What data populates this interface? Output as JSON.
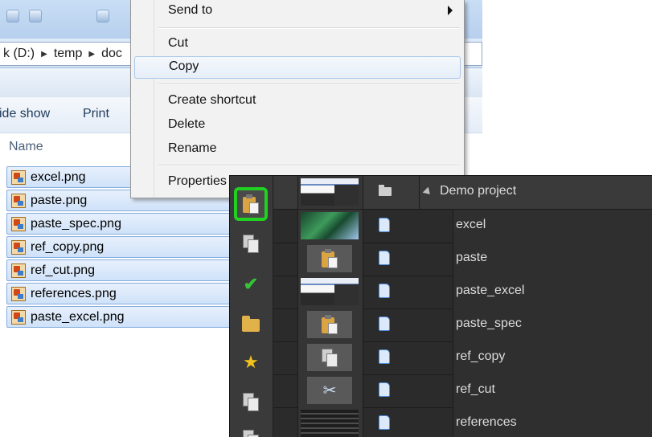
{
  "explorer": {
    "breadcrumb": [
      "k (D:)",
      "temp",
      "doc"
    ],
    "toolbar": {
      "slideshow_label": "ide show",
      "print_label": "Print"
    },
    "column_name": "Name",
    "files": [
      "excel.png",
      "paste.png",
      "paste_spec.png",
      "ref_copy.png",
      "ref_cut.png",
      "references.png",
      "paste_excel.png"
    ]
  },
  "context_menu": {
    "send_to": "Send to",
    "cut": "Cut",
    "copy": "Copy",
    "create_shortcut": "Create shortcut",
    "delete": "Delete",
    "rename": "Rename",
    "properties": "Properties"
  },
  "app_panel": {
    "project_name": "Demo project",
    "items": [
      "excel",
      "paste",
      "paste_excel",
      "paste_spec",
      "ref_copy",
      "ref_cut",
      "references"
    ],
    "sidebar_icons": [
      "paste-icon",
      "paste-special-icon",
      "check-icon",
      "open-folder-icon",
      "star-icon",
      "copy-icon",
      "document-icon"
    ],
    "accent_color": "#22d022"
  }
}
